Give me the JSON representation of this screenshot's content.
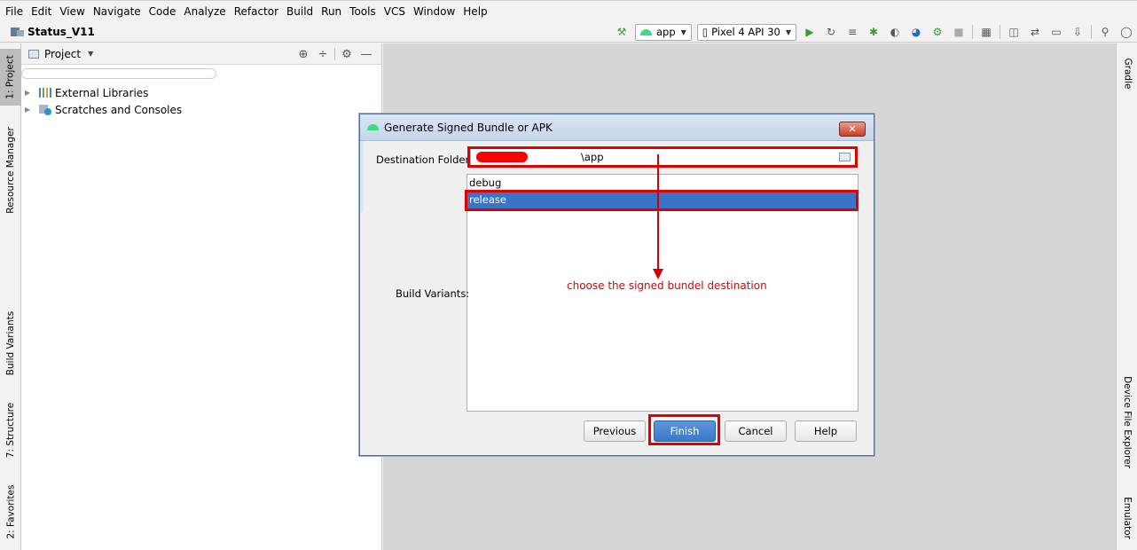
{
  "menu": [
    "File",
    "Edit",
    "View",
    "Navigate",
    "Code",
    "Analyze",
    "Refactor",
    "Build",
    "Run",
    "Tools",
    "VCS",
    "Window",
    "Help"
  ],
  "breadcrumb": {
    "project": "Status_V11"
  },
  "toolbar": {
    "run_config": "app",
    "device": "Pixel 4 API 30",
    "icons": [
      "hammer-icon",
      "run-icon",
      "rerun-icon",
      "coverage-icon",
      "debug-icon",
      "attach-icon",
      "profile-icon",
      "apply-changes-icon",
      "stop-icon",
      "project-structure-icon",
      "terminal-icon",
      "sync-icon",
      "avd-manager-icon",
      "sdk-manager-icon",
      "search-icon",
      "account-icon"
    ]
  },
  "left_tabs": [
    "1: Project",
    "Resource Manager",
    "Build Variants",
    "7: Structure",
    "2: Favorites"
  ],
  "right_tabs": [
    "Gradle",
    "Device File Explorer",
    "Emulator"
  ],
  "project_panel": {
    "view_mode": "Project",
    "tree": [
      "External Libraries",
      "Scratches and Consoles"
    ]
  },
  "dialog": {
    "title": "Generate Signed Bundle or APK",
    "destination_label": "Destination Folder:",
    "destination_suffix": "\\app",
    "build_variants_label": "Build Variants:",
    "variants": [
      {
        "name": "debug",
        "selected": false
      },
      {
        "name": "release",
        "selected": true
      }
    ],
    "buttons": {
      "previous": "Previous",
      "finish": "Finish",
      "cancel": "Cancel",
      "help": "Help"
    }
  },
  "annotation": {
    "text": "choose the signed bundel destination",
    "color": "#e00000"
  },
  "colors": {
    "accent": "#3875c8",
    "android": "#3ddc84",
    "annotation": "#e00000"
  }
}
